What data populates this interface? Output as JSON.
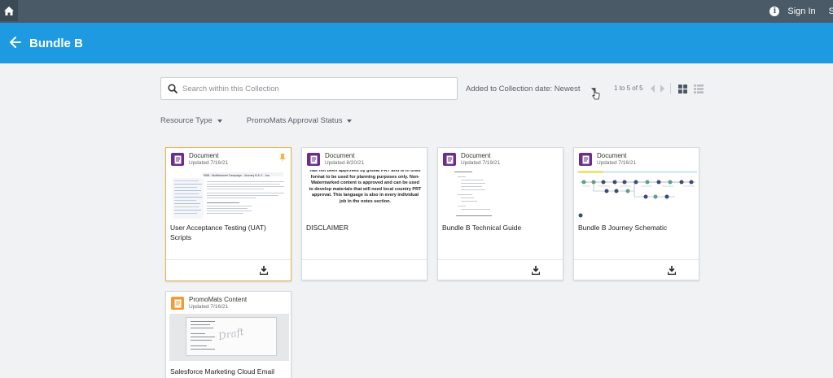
{
  "topbar": {
    "signin_label": "Sign In",
    "extra_label": "S",
    "info_glyph": "i",
    "home_icon": "home-icon"
  },
  "header": {
    "title": "Bundle B",
    "back_icon": "arrow-left-icon",
    "color": "#1e9ae0"
  },
  "search": {
    "placeholder": "Search within this Collection",
    "value": ""
  },
  "sort": {
    "label": "Added to Collection date: Newest"
  },
  "pager": {
    "label": "1 to 5 of 5"
  },
  "filters": {
    "resource_type": "Resource Type",
    "approval_status": "PromoMats Approval Status"
  },
  "cards": [
    {
      "type": "Document",
      "updated": "Updated 7/16/21",
      "title": "User Acceptance Testing (UAT) Scripts",
      "pinned": true,
      "selected": true,
      "thumb_text": "SBB - Multichannel Campaign - Journey B & C - Jou"
    },
    {
      "type": "Document",
      "updated": "Updated 8/20/21",
      "title": "DISCLAIMER",
      "thumb_text": "has not been approved by global PRT and is in draft format to be used for planning purposes only.  Non-Watermarked content is approved and can be used to develop materials that will need local country PRT approval.  This language is also in every individual job in the notes section."
    },
    {
      "type": "Document",
      "updated": "Updated 7/19/21",
      "title": "Bundle B Technical Guide"
    },
    {
      "type": "Document",
      "updated": "Updated 7/16/21",
      "title": "Bundle B Journey Schematic"
    },
    {
      "type": "PromoMats Content",
      "updated": "Updated 7/16/21",
      "title": "Salesforce Marketing Cloud Email",
      "thumb_watermark": "Draft"
    }
  ],
  "colors": {
    "document_icon": "#6b2d91",
    "promomats_icon": "#f29b36",
    "selected_border": "#e5b64c",
    "pin": "#f2b526"
  }
}
